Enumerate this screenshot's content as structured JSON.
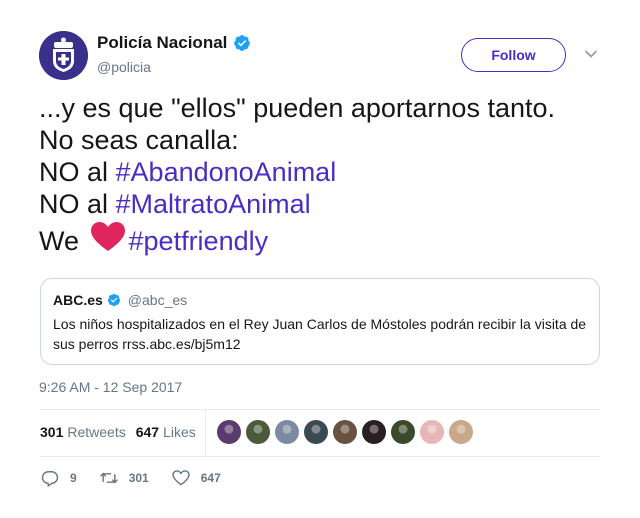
{
  "author": {
    "display_name": "Policía Nacional",
    "handle": "@policia",
    "avatar_icon": "police-badge-avatar",
    "verified": true
  },
  "header": {
    "follow_label": "Follow",
    "menu_icon": "chevron-down-icon"
  },
  "tweet": {
    "line1": "...y es que \"ellos\" pueden aportarnos tanto.",
    "line2": "No seas canalla:",
    "line3_prefix": "NO al ",
    "line3_hashtag": "#AbandonoAnimal",
    "line4_prefix": "NO al ",
    "line4_hashtag": "#MaltratoAnimal",
    "line5_prefix": "We ",
    "line5_emoji": "red-heart-emoji",
    "line5_hashtag": "#petfriendly"
  },
  "quote": {
    "name": "ABC.es",
    "handle": "@abc_es",
    "verified": true,
    "text": "Los niños hospitalizados en el Rey Juan Carlos de Móstoles podrán recibir la visita de sus perros rrss.abc.es/bj5m12"
  },
  "timestamp": "9:26 AM - 12 Sep 2017",
  "stats": {
    "retweets_count": "301",
    "retweets_label": "Retweets",
    "likes_count": "647",
    "likes_label": "Likes"
  },
  "likers": [
    {
      "color": "#5b3b6e"
    },
    {
      "color": "#4d5a3a"
    },
    {
      "color": "#7a8aa0"
    },
    {
      "color": "#3b4a52"
    },
    {
      "color": "#6a5240"
    },
    {
      "color": "#2a2024"
    },
    {
      "color": "#3a4a2a"
    },
    {
      "color": "#e7b7b7"
    },
    {
      "color": "#c9a88a"
    }
  ],
  "actions": {
    "reply_count": "9",
    "retweet_count": "301",
    "like_count": "647"
  },
  "colors": {
    "accent": "#4a2ec4",
    "verified_blue": "#1da1f2",
    "muted": "#657786",
    "heart_red": "#e0245e"
  }
}
